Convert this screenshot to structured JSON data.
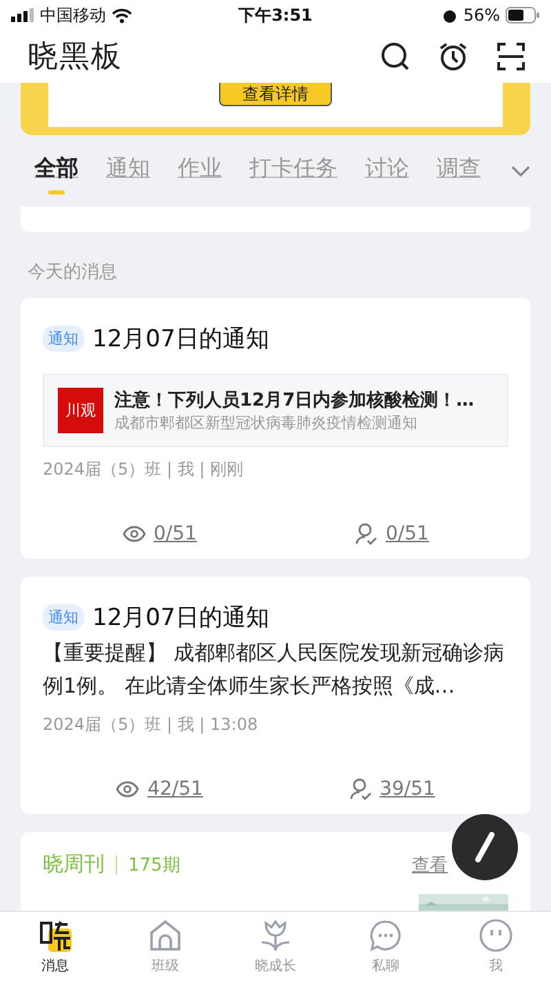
{
  "status_bar": {
    "carrier": "中国移动",
    "time": "下午3:51",
    "battery": "56%"
  },
  "header": {
    "title": "晓黑板"
  },
  "banner": {
    "button": "查看详情"
  },
  "tabs": [
    {
      "label": "全部",
      "selected": true
    },
    {
      "label": "通知",
      "selected": false
    },
    {
      "label": "作业",
      "selected": false
    },
    {
      "label": "打卡任务",
      "selected": false
    },
    {
      "label": "讨论",
      "selected": false
    },
    {
      "label": "调查",
      "selected": false
    }
  ],
  "section_label": "今天的消息",
  "messages": [
    {
      "tag": "通知",
      "title": "12月07日的通知",
      "kind": "link",
      "link": {
        "logo": "川观",
        "title": "注意！下列人员12月7日内参加核酸检测！…",
        "subtitle": "成都市郫都区新型冠状病毒肺炎疫情检测通知"
      },
      "meta": "2024届（5）班 | 我 | 刚刚",
      "views": "0/51",
      "confirms": "0/51"
    },
    {
      "tag": "通知",
      "title": "12月07日的通知",
      "kind": "text",
      "body": "【重要提醒】 成都郫都区人民医院发现新冠确诊病例1例。 在此请全体师生家长严格按照《成…",
      "meta": "2024届（5）班 | 我 | 13:08",
      "views": "42/51",
      "confirms": "39/51"
    }
  ],
  "weekly": {
    "brand": "晓周刊",
    "issue": "175期",
    "more": "查看"
  },
  "bottom_nav": [
    {
      "label": "消息",
      "selected": true
    },
    {
      "label": "班级",
      "selected": false
    },
    {
      "label": "晓成长",
      "selected": false
    },
    {
      "label": "私聊",
      "selected": false
    },
    {
      "label": "我",
      "selected": false
    }
  ]
}
